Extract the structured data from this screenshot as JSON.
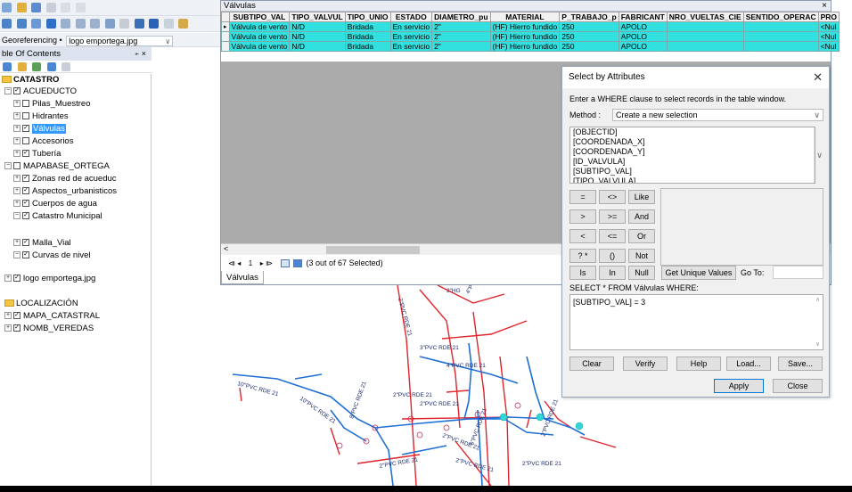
{
  "georef": {
    "label": "Georeferencing •",
    "layer": "logo emportega.jpg"
  },
  "toc": {
    "title": "ble Of Contents",
    "pin": "⍅ ×",
    "items": [
      {
        "label": "CATASTRO"
      },
      {
        "label": "ACUEDUCTO"
      },
      {
        "label": "Pilas_Muestreo"
      },
      {
        "label": "Hidrantes"
      },
      {
        "label": "Válvulas"
      },
      {
        "label": "Accesorios"
      },
      {
        "label": "Tubería"
      },
      {
        "label": "MAPABASE_ORTEGA"
      },
      {
        "label": "Zonas red de acueduc"
      },
      {
        "label": "Aspectos_urbanisticos"
      },
      {
        "label": "Cuerpos de agua"
      },
      {
        "label": "Catastro Municipal"
      },
      {
        "label": "Malla_Vial"
      },
      {
        "label": "Curvas de nivel"
      },
      {
        "label": "logo emportega.jpg"
      },
      {
        "label": "LOCALIZACIÓN"
      },
      {
        "label": "MAPA_CATASTRAL"
      },
      {
        "label": "NOMB_VEREDAS"
      }
    ]
  },
  "attribute_table": {
    "title": "Válvulas",
    "close": "×",
    "columns": [
      "SUBTIPO_VAL",
      "TIPO_VALVUL",
      "TIPO_UNIO",
      "ESTADO",
      "DIAMETRO_pu",
      "MATERIAL",
      "P_TRABAJO_p",
      "FABRICANT",
      "NRO_VUELTAS_CIE",
      "SENTIDO_OPERAC",
      "PRO"
    ],
    "rows": [
      {
        "marker": "▸",
        "cells": [
          "Válvula de vento",
          "N/D",
          "Bridada",
          "En servicio",
          "2\"",
          "(HF) Hierro fundido",
          "250",
          "APOLO",
          "",
          "",
          "<Nul"
        ]
      },
      {
        "marker": "",
        "cells": [
          "Válvula de vento",
          "N/D",
          "Bridada",
          "En servicio",
          "2\"",
          "(HF) Hierro fundido",
          "250",
          "APOLO",
          "",
          "",
          "<Nul"
        ]
      },
      {
        "marker": "",
        "cells": [
          "Válvula de vento",
          "N/D",
          "Bridada",
          "En servicio",
          "2\"",
          "(HF) Hierro fundido",
          "250",
          "APOLO",
          "",
          "",
          "<Nul"
        ]
      }
    ],
    "nav": {
      "first": "⧏ ◂",
      "record": "1",
      "next": "▸ ⧐",
      "status": "(3 out of 67 Selected)"
    },
    "tab": "Válvulas"
  },
  "dialog": {
    "title": "Select by Attributes",
    "close": "✕",
    "instruction": "Enter a WHERE clause to select records in the table window.",
    "method_label": "Method :",
    "method_value": "Create a new selection",
    "fields": [
      "[OBJECTID]",
      "[COORDENADA_X]",
      "[COORDENADA_Y]",
      "[ID_VALVULA]",
      "[SUBTIPO_VAL]",
      "[TIPO_VALVULA]"
    ],
    "operators": [
      "=",
      "<>",
      "Like",
      ">",
      ">=",
      "And",
      "<",
      "<=",
      "Or",
      "? *",
      "()",
      "Not"
    ],
    "is_label": "Is",
    "in_label": "In",
    "null_label": "Null",
    "get_unique_values": "Get Unique Values",
    "goto_label": "Go To:",
    "select_from": "SELECT * FROM Válvulas WHERE:",
    "where_clause": "[SUBTIPO_VAL] = 3",
    "clear": "Clear",
    "verify": "Verify",
    "help": "Help",
    "load": "Load...",
    "save": "Save...",
    "apply": "Apply",
    "close_button": "Close"
  },
  "map_labels": [
    "2\"PVC RDE 21",
    "2\"HG",
    "4\"PVC RDE 21",
    "3\"PVC RDE 21",
    "6\"PVC RDE 21",
    "8\"PVC RDE 21",
    "10\"PVC RDE 21",
    "2\"PVC RDE 21"
  ],
  "colors": {
    "selection": "#33e0e0",
    "toc_selected": "#3399ff",
    "pipe_main": "#1f6fd6",
    "pipe_secondary": "#e0242c"
  }
}
